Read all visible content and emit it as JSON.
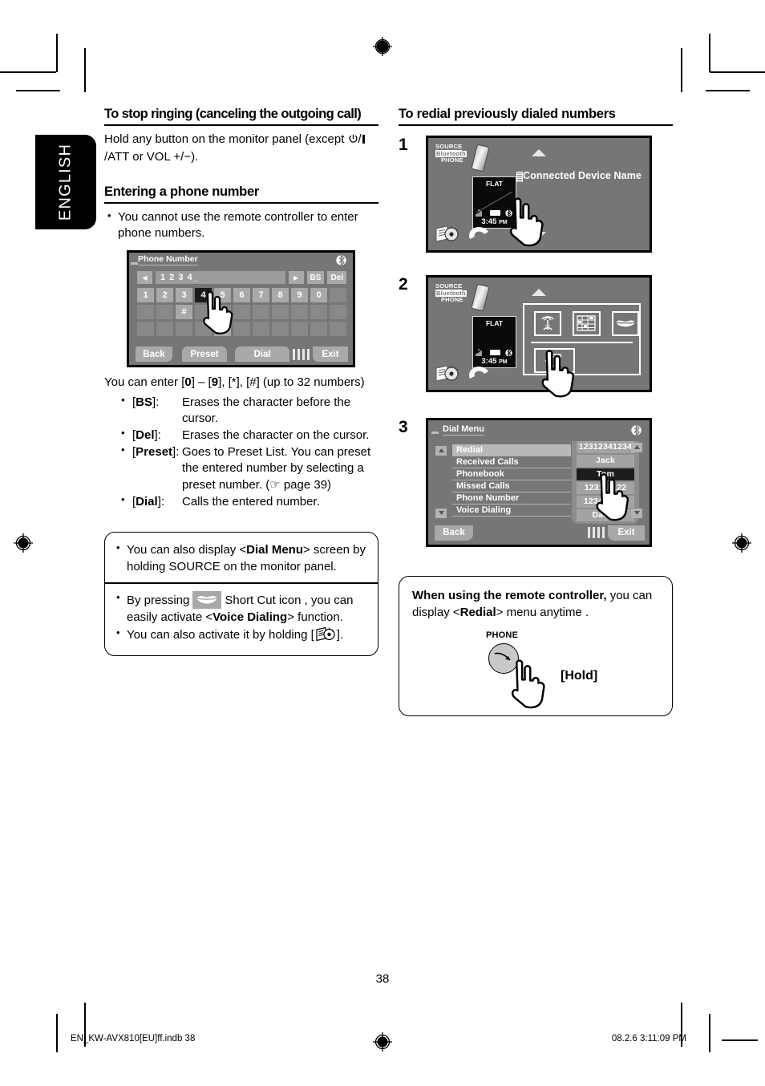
{
  "language_tab": {
    "label": "ENGLISH"
  },
  "left_column": {
    "section1": {
      "heading": "To stop ringing (canceling the outgoing call)",
      "paragraph_prefix": "Hold any button on the monitor panel (except ",
      "paragraph_icon": "power-icon",
      "paragraph_mid": "/",
      "paragraph_suffix": "/ATT or VOL +/−)."
    },
    "section2": {
      "heading": "Entering a phone number",
      "bullet": "You cannot use the remote controller to enter phone numbers.",
      "phone_screen": {
        "title": "Phone Number",
        "bluetooth_icon": "bluetooth-icon",
        "left_arrow": "◀",
        "right_arrow": "▶",
        "entry_value": "1 2 3 4_",
        "bs_label": "BS",
        "del_label": "Del",
        "keys_row1": [
          "1",
          "2",
          "3",
          "4",
          "5",
          "6",
          "7",
          "8",
          "9",
          "0"
        ],
        "selected_key": "4",
        "keys_row2": [
          "",
          "",
          "#",
          "",
          "",
          "",
          "",
          "",
          "",
          ""
        ],
        "keys_row3": [
          "",
          "",
          "",
          "",
          "*",
          "",
          "",
          "",
          "",
          ""
        ],
        "back_label": "Back",
        "preset_label": "Preset",
        "dial_label": "Dial",
        "exit_label": "Exit"
      },
      "enter_line": "You can enter [0] – [9], [*], [#] (up to 32 numbers)",
      "key_defs": [
        {
          "key": "[BS]:",
          "def": "Erases the character before the cursor."
        },
        {
          "key": "[Del]:",
          "def": "Erases the character on the cursor."
        },
        {
          "key": "[Preset]:",
          "def": "Goes to Preset List. You can preset the entered number by selecting a preset number. (☞ page 39)"
        },
        {
          "key": "[Dial]:",
          "def": "Calls the entered number."
        }
      ]
    },
    "note_box": {
      "bullet1_pre": "You can also display <",
      "bullet1_bold": "Dial Menu",
      "bullet1_post": "> screen by holding SOURCE on the monitor panel.",
      "bullet2_pre": "By pressing",
      "bullet2_icon": "lips-shortcut-icon",
      "bullet2_mid": "Short Cut icon , you can easily activate <",
      "bullet2_bold": "Voice Dialing",
      "bullet2_post": "> function.",
      "bullet3_pre": "You can also activate it by holding [",
      "bullet3_icon": "disc-menu-icon",
      "bullet3_post": "]."
    }
  },
  "right_column": {
    "heading": "To redial previously dialed numbers",
    "steps": [
      {
        "number": "1",
        "screen": {
          "source_line1": "SOURCE",
          "source_line2": "Bluetooth",
          "source_line3": "PHONE",
          "flat_label": "FLAT",
          "clock": "3:45",
          "clock_ampm": "PM",
          "device_name": "Connected Device Name",
          "arrow_up": "▲",
          "arrow_down": "▼"
        }
      },
      {
        "number": "2",
        "screen": {
          "source_line1": "SOURCE",
          "source_line2": "Bluetooth",
          "source_line3": "PHONE",
          "flat_label": "FLAT",
          "clock": "3:45",
          "clock_ampm": "PM",
          "arrow_up": "▲",
          "icons": [
            "antenna-icon",
            "keypad-icon",
            "lips-icon",
            "redial-exit-icon"
          ]
        }
      },
      {
        "number": "3",
        "screen": {
          "title": "Dial Menu",
          "bluetooth_icon": "bluetooth-icon",
          "menu_items": [
            "Redial",
            "Received Calls",
            "Phonebook",
            "Missed Calls",
            "Phone Number",
            "Voice Dialing"
          ],
          "selected_menu_item": "Redial",
          "entries": [
            "12312341234",
            "Jack",
            "Tom",
            "123111122",
            "123456789",
            "Daddy"
          ],
          "selected_entry": "Tom",
          "back_label": "Back",
          "exit_label": "Exit"
        }
      }
    ],
    "note_box": {
      "line_bold": "When using the remote controller,",
      "line_rest": " you can display <",
      "line_bold2": "Redial",
      "line_rest2": "> menu anytime .",
      "phone_button_label": "PHONE",
      "hold_label": "[Hold]"
    }
  },
  "footer": {
    "page_number": "38",
    "file_name": "EN_KW-AVX810[EU]ff.indb   38",
    "timestamp": "08.2.6   3:11:09 PM"
  }
}
